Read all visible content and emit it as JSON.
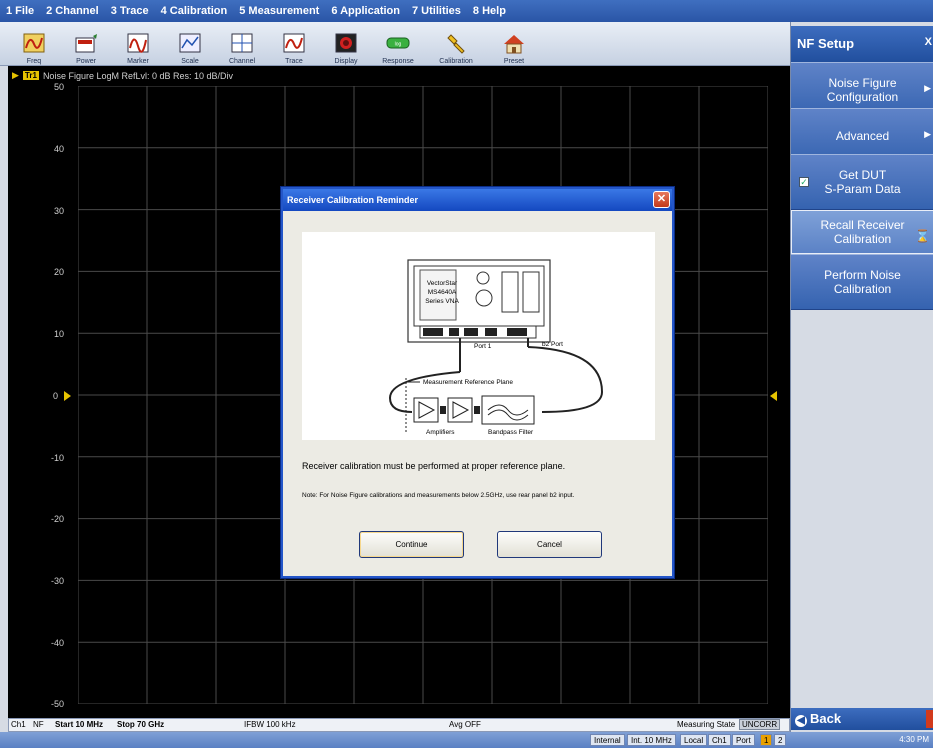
{
  "menu": [
    "1 File",
    "2 Channel",
    "3 Trace",
    "4 Calibration",
    "5 Measurement",
    "6 Application",
    "7 Utilities",
    "8 Help"
  ],
  "toolbar": [
    {
      "label": "Freq",
      "icon": "freq-icon"
    },
    {
      "label": "Power",
      "icon": "power-icon"
    },
    {
      "label": "Marker",
      "icon": "marker-icon"
    },
    {
      "label": "Scale",
      "icon": "scale-icon"
    },
    {
      "label": "Channel",
      "icon": "channel-icon"
    },
    {
      "label": "Trace",
      "icon": "trace-icon"
    },
    {
      "label": "Display",
      "icon": "display-icon"
    },
    {
      "label": "Response",
      "icon": "response-icon"
    },
    {
      "label": "Calibration",
      "icon": "calibration-icon"
    },
    {
      "label": "Preset",
      "icon": "preset-icon"
    }
  ],
  "trace": {
    "badge": "Tr1",
    "title": "Noise Figure LogM RefLvl: 0 dB Res: 10 dB/Div",
    "y_labels": [
      "50",
      "40",
      "30",
      "20",
      "10",
      "0",
      "-10",
      "-20",
      "-30",
      "-40",
      "-50"
    ]
  },
  "status": {
    "ch": "Ch1",
    "mode": "NF",
    "start": "Start 10 MHz",
    "stop": "Stop 70 GHz",
    "ifbw": "IFBW 100 kHz",
    "avg": "Avg OFF",
    "measuring_state": "Measuring State",
    "uncorr": "UNCORR"
  },
  "bottom": {
    "internal": "Internal",
    "ref": "Int. 10 MHz",
    "local": "Local",
    "ch": "Ch1",
    "port": "Port",
    "port1": "1",
    "port2": "2",
    "time": "4:30 PM"
  },
  "panel": {
    "title": "NF Setup",
    "close": "X",
    "buttons": [
      {
        "label1": "Noise Figure",
        "label2": "Configuration"
      },
      {
        "label1": "Advanced",
        "label2": ""
      },
      {
        "label1": "Get DUT",
        "label2": "S-Param Data"
      },
      {
        "label1": "Recall Receiver",
        "label2": "Calibration"
      },
      {
        "label1": "Perform Noise",
        "label2": "Calibration"
      }
    ],
    "back": "Back"
  },
  "dialog": {
    "title": "Receiver Calibration Reminder",
    "vna_line1": "VectorStar",
    "vna_line2": "MS4640A",
    "vna_line3": "Series VNA",
    "port1": "Port 1",
    "b2port": "b2 Port",
    "ref_plane": "Measurement Reference Plane",
    "amplifiers": "Amplifiers",
    "filter": "Bandpass Filter",
    "message": "Receiver calibration must be performed at proper reference plane.",
    "note": "Note: For Noise Figure calibrations and measurements below 2.5GHz, use rear panel b2 input.",
    "continue": "Continue",
    "cancel": "Cancel"
  },
  "colors": {
    "trace_yellow": "#e6c300",
    "title_blue": "#2a55a6",
    "panel_button": "#3563b0"
  }
}
